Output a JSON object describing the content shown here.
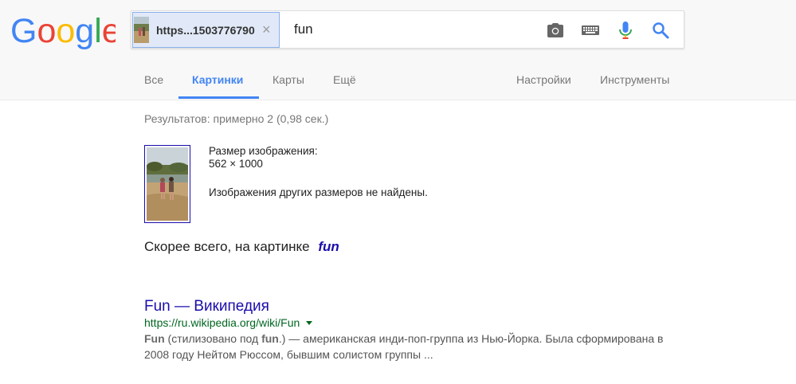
{
  "header": {
    "logo_text": "Google",
    "search": {
      "chip_text": "https...1503776790",
      "query": "fun"
    }
  },
  "tabs": [
    {
      "label": "Все"
    },
    {
      "label": "Картинки"
    },
    {
      "label": "Карты"
    },
    {
      "label": "Ещё"
    },
    {
      "label": "Настройки"
    },
    {
      "label": "Инструменты"
    }
  ],
  "stats": "Результатов: примерно 2 (0,98 сек.)",
  "image_info": {
    "size_label": "Размер изображения:",
    "size_value": "562 × 1000",
    "no_other_sizes": "Изображения других размеров не найдены."
  },
  "best_guess": {
    "prefix": "Скорее всего, на картинке",
    "term": "fun"
  },
  "result": {
    "title": "Fun — Википедия",
    "url": "https://ru.wikipedia.org/wiki/Fun",
    "snippet_bold_1": "Fun",
    "snippet_part_1": " (стилизовано под ",
    "snippet_bold_2": "fun",
    "snippet_part_2": ".) — американская инди-поп-группа из Нью-Йорка. Была сформирована в 2008 году Нейтом Рюссом, бывшим солистом группы ..."
  },
  "colors": {
    "google_blue": "#4285f4",
    "google_red": "#ea4335",
    "google_yellow": "#fbbc05",
    "google_green": "#34a853",
    "link": "#1a0dab",
    "url_green": "#006621"
  },
  "icons": [
    "camera-icon",
    "keyboard-icon",
    "microphone-icon",
    "search-icon",
    "close-icon",
    "dropdown-arrow-icon"
  ]
}
